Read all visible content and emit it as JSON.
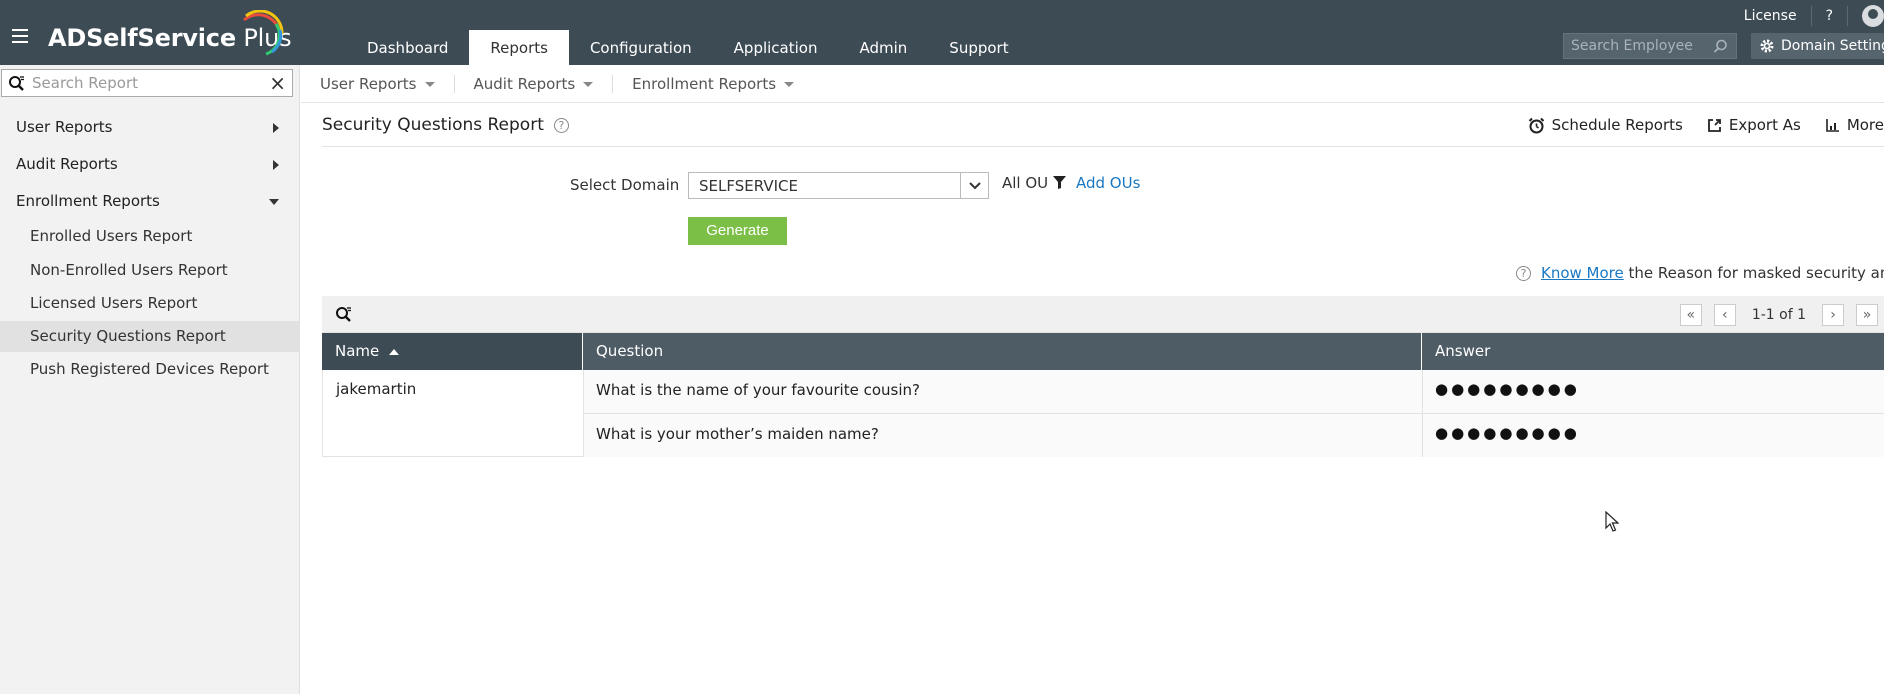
{
  "app": {
    "brand_main": "ADSelfService",
    "brand_suffix": " Plus"
  },
  "topnav": {
    "tabs": [
      "Dashboard",
      "Reports",
      "Configuration",
      "Application",
      "Admin",
      "Support"
    ],
    "active": "Reports",
    "license": "License",
    "help": "?",
    "employee_search_placeholder": "Search Employee",
    "domain_settings": "Domain Settings"
  },
  "sidebar": {
    "search_placeholder": "Search Report",
    "groups": [
      {
        "label": "User Reports",
        "expanded": false
      },
      {
        "label": "Audit Reports",
        "expanded": false
      },
      {
        "label": "Enrollment Reports",
        "expanded": true
      }
    ],
    "items": [
      "Enrolled Users Report",
      "Non-Enrolled Users Report",
      "Licensed Users Report",
      "Security Questions Report",
      "Push Registered Devices Report"
    ],
    "selected": "Security Questions Report"
  },
  "subnav": [
    "User Reports",
    "Audit Reports",
    "Enrollment Reports"
  ],
  "page": {
    "title": "Security Questions Report",
    "actions": {
      "schedule": "Schedule Reports",
      "export": "Export As",
      "more": "More"
    }
  },
  "form": {
    "domain_label": "Select Domain",
    "domain_value": "SELFSERVICE",
    "ou_label": "All OU",
    "add_ous": "Add OUs",
    "generate": "Generate"
  },
  "note": {
    "link": "Know More",
    "text": " the Reason for masked security answers"
  },
  "table": {
    "pager_text": "1-1 of 1",
    "columns": [
      "Name",
      "Question",
      "Answer"
    ],
    "rows": [
      {
        "name": "jakemartin",
        "questions": [
          {
            "question": "What is the name of your favourite cousin?",
            "answer": "●●●●●●●●●"
          },
          {
            "question": "What is your mother’s maiden name?",
            "answer": "●●●●●●●●●"
          }
        ]
      }
    ]
  },
  "colors": {
    "topbar": "#3d4b55",
    "accent_green": "#7cbf46",
    "link_blue": "#1a78c2"
  }
}
